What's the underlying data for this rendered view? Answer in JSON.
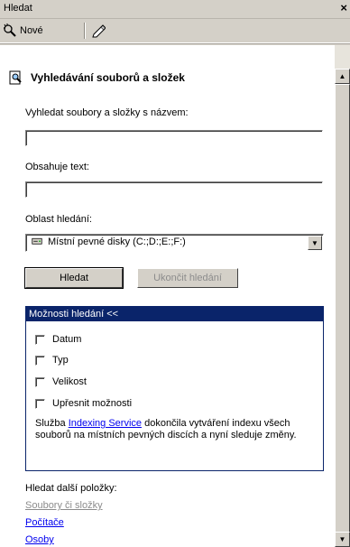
{
  "window": {
    "title": "Hledat",
    "close_glyph": "×"
  },
  "toolbar": {
    "new_label": "Nové",
    "new_icon": "new-search-icon",
    "edit_icon": "edit-pencil-icon"
  },
  "panel": {
    "heading": "Vyhledávání souborů a složek",
    "name_label": "Vyhledat soubory a složky s názvem:",
    "name_value": "",
    "text_label": "Obsahuje text:",
    "text_value": "",
    "area_label": "Oblast hledání:",
    "area_value": "Místní pevné disky (C:;D:;E:;F:)",
    "search_button": "Hledat",
    "stop_button": "Ukončit hledání"
  },
  "options": {
    "header": "Možnosti hledání <<",
    "items": [
      {
        "label": "Datum",
        "checked": false
      },
      {
        "label": "Typ",
        "checked": false
      },
      {
        "label": "Velikost",
        "checked": false
      },
      {
        "label": "Upřesnit možnosti",
        "checked": false
      }
    ],
    "note_prefix": "Služba ",
    "note_link": "Indexing Service",
    "note_suffix": " dokončila vytváření indexu všech souborů na místních pevných discích a nyní sleduje změny."
  },
  "more": {
    "label": "Hledat další položky:",
    "links": [
      "Soubory či složky",
      "Počítače",
      "Osoby"
    ]
  },
  "colors": {
    "header_bg": "#0a246a",
    "link": "#0000ee",
    "disabled": "#8c8c8c"
  }
}
